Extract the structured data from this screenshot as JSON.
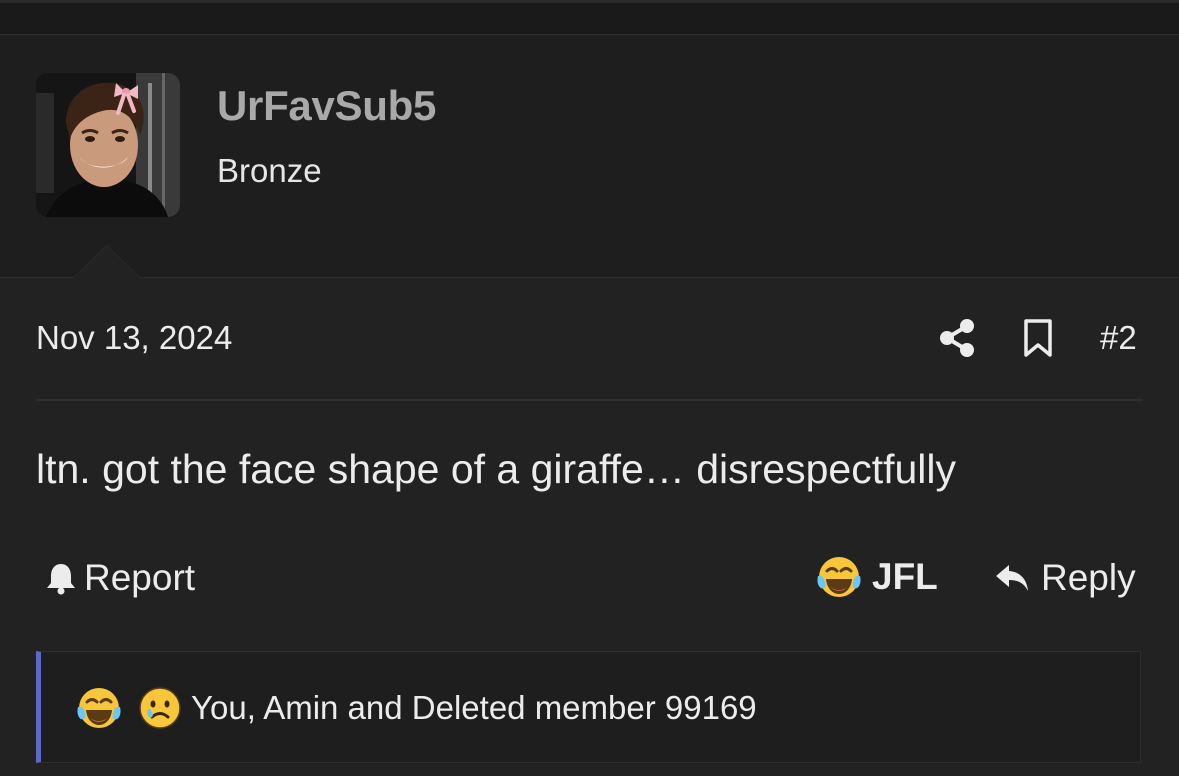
{
  "user": {
    "username": "UrFavSub5",
    "rank": "Bronze",
    "avatar_icon": "avatar-photo"
  },
  "post": {
    "date": "Nov 13, 2024",
    "number": "#2",
    "message": "ltn. got the face shape of a giraffe… disrespectfully",
    "share_icon": "share-icon",
    "bookmark_icon": "bookmark-icon"
  },
  "actions": {
    "report_label": "Report",
    "report_icon": "bell-icon",
    "reaction_label": "JFL",
    "reaction_icon": "tears-of-joy-icon",
    "reply_label": "Reply",
    "reply_icon": "reply-arrow-icon"
  },
  "reactions_bar": {
    "icons": [
      "tears-of-joy-icon",
      "sad-face-icon"
    ],
    "text": "You, Amin and Deleted member 99169",
    "accent_color": "#5b6ac4"
  },
  "colors": {
    "background": "#222222",
    "username": "#a9a9a9",
    "text": "#ececec"
  }
}
